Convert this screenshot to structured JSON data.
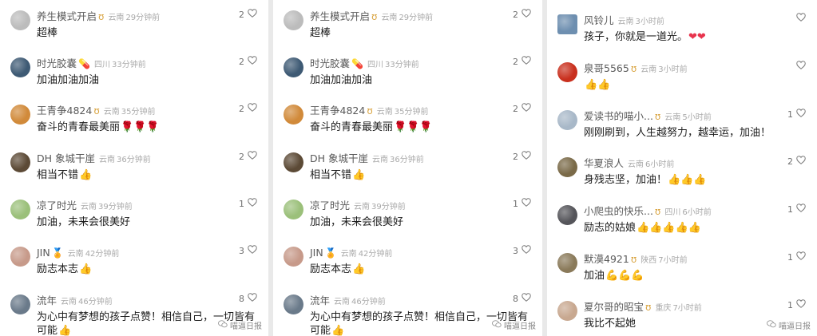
{
  "watermark": "喵逼日报",
  "panels": [
    {
      "comments": [
        {
          "user": "养生模式开启",
          "badge": "v",
          "location": "云南",
          "time": "29分钟前",
          "text": "超棒",
          "emoji": "",
          "likes": "2",
          "avatar": "#bcbcbc"
        },
        {
          "user": "时光胶囊",
          "badge": "pill",
          "location": "四川",
          "time": "33分钟前",
          "text": "加油加油加油",
          "emoji": "",
          "likes": "2",
          "avatar": "#3e5a74"
        },
        {
          "user": "王青争4824",
          "badge": "v",
          "location": "云南",
          "time": "35分钟前",
          "text": "奋斗的青春最美丽",
          "emoji": "🌹🌹🌹",
          "likes": "2",
          "avatar": "#d18a3a"
        },
        {
          "user": "DH 象城干崖",
          "badge": "",
          "location": "云南",
          "time": "36分钟前",
          "text": "相当不错",
          "emoji": "👍",
          "likes": "2",
          "avatar": "#5c4a36"
        },
        {
          "user": "凉了时光",
          "badge": "",
          "location": "云南",
          "time": "39分钟前",
          "text": "加油，未来会很美好",
          "emoji": "",
          "likes": "1",
          "avatar": "#9bc07a"
        },
        {
          "user": "JIN",
          "badge": "medal",
          "location": "云南",
          "time": "42分钟前",
          "text": "励志本志",
          "emoji": "👍",
          "likes": "3",
          "avatar": "#c79a8a"
        },
        {
          "user": "流年",
          "badge": "",
          "location": "云南",
          "time": "46分钟前",
          "text": "为心中有梦想的孩子点赞！相信自己，一切皆有可能",
          "emoji": "👍",
          "likes": "8",
          "avatar": "#6a7a8a"
        }
      ]
    },
    {
      "comments": [
        {
          "user": "养生模式开启",
          "badge": "v",
          "location": "云南",
          "time": "29分钟前",
          "text": "超棒",
          "emoji": "",
          "likes": "2",
          "avatar": "#bcbcbc"
        },
        {
          "user": "时光胶囊",
          "badge": "pill",
          "location": "四川",
          "time": "33分钟前",
          "text": "加油加油加油",
          "emoji": "",
          "likes": "2",
          "avatar": "#3e5a74"
        },
        {
          "user": "王青争4824",
          "badge": "v",
          "location": "云南",
          "time": "35分钟前",
          "text": "奋斗的青春最美丽",
          "emoji": "🌹🌹🌹",
          "likes": "2",
          "avatar": "#d18a3a"
        },
        {
          "user": "DH 象城干崖",
          "badge": "",
          "location": "云南",
          "time": "36分钟前",
          "text": "相当不错",
          "emoji": "👍",
          "likes": "2",
          "avatar": "#5c4a36"
        },
        {
          "user": "凉了时光",
          "badge": "",
          "location": "云南",
          "time": "39分钟前",
          "text": "加油，未来会很美好",
          "emoji": "",
          "likes": "1",
          "avatar": "#9bc07a"
        },
        {
          "user": "JIN",
          "badge": "medal",
          "location": "云南",
          "time": "42分钟前",
          "text": "励志本志",
          "emoji": "👍",
          "likes": "3",
          "avatar": "#c79a8a"
        },
        {
          "user": "流年",
          "badge": "",
          "location": "云南",
          "time": "46分钟前",
          "text": "为心中有梦想的孩子点赞！相信自己，一切皆有可能",
          "emoji": "👍",
          "likes": "8",
          "avatar": "#6a7a8a"
        }
      ]
    },
    {
      "comments": [
        {
          "user": "风铃儿",
          "badge": "",
          "location": "云南",
          "time": "3小时前",
          "text": "孩子，你就是一道光。",
          "emoji": "❤❤",
          "likes": "",
          "avatar": "#6e8fb0"
        },
        {
          "user": "泉哥5565",
          "badge": "v",
          "location": "云南",
          "time": "3小时前",
          "text": "",
          "emoji": "👍👍",
          "likes": "",
          "avatar": "#c9301e"
        },
        {
          "user": "爱读书的喵小...",
          "badge": "v",
          "location": "云南",
          "time": "5小时前",
          "text": "刚刚刷到，人生越努力，越幸运，加油！",
          "emoji": "",
          "likes": "1",
          "avatar": "#a8b8c8"
        },
        {
          "user": "华夏浪人",
          "badge": "",
          "location": "云南",
          "time": "6小时前",
          "text": "身残志坚，加油！",
          "emoji": "👍👍👍",
          "likes": "2",
          "avatar": "#7a6a48"
        },
        {
          "user": "小爬虫的快乐...",
          "badge": "v",
          "location": "四川",
          "time": "6小时前",
          "text": "励志的姑娘",
          "emoji": "👍👍👍👍👍",
          "likes": "1",
          "avatar": "#55555a"
        },
        {
          "user": "默漠4921",
          "badge": "v",
          "location": "陕西",
          "time": "7小时前",
          "text": "加油",
          "emoji": "💪💪💪",
          "likes": "1",
          "avatar": "#8a7a5a"
        },
        {
          "user": "夏尔哥的昭宝",
          "badge": "v",
          "location": "重庆",
          "time": "7小时前",
          "text": "我比不起她",
          "emoji": "",
          "likes": "1",
          "avatar": "#c8a890"
        }
      ]
    }
  ]
}
